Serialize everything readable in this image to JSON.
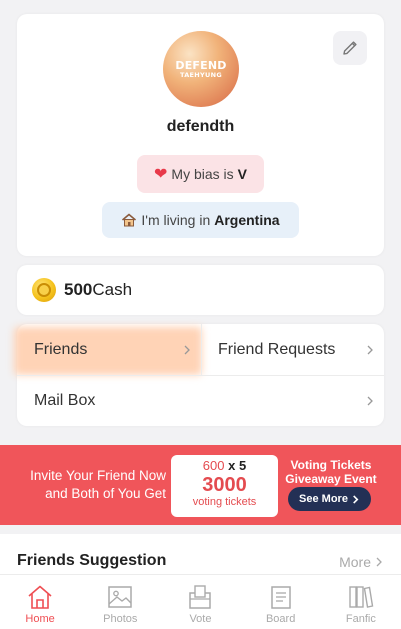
{
  "profile": {
    "avatar_line1": "DEFEND",
    "avatar_line2": "TAEHYUNG",
    "username": "defendth",
    "bias_prefix": "My bias is",
    "bias_value": "V",
    "living_prefix": "I'm living in",
    "living_value": "Argentina"
  },
  "cash": {
    "amount": "500",
    "unit": "Cash"
  },
  "menu": {
    "friends": "Friends",
    "friend_requests": "Friend Requests",
    "mail_box": "Mail Box"
  },
  "banner": {
    "left_line1": "Invite Your Friend Now",
    "left_line2": "and Both of You Get",
    "ticket_count": "600",
    "ticket_times": "x 5",
    "ticket_total": "3000",
    "ticket_unit": "voting tickets",
    "right_line1": "Voting Tickets",
    "right_line2": "Giveaway Event",
    "see_more": "See More"
  },
  "suggestion": {
    "title": "Friends Suggestion",
    "more": "More"
  },
  "tabs": [
    {
      "label": "Home",
      "icon": "home-icon",
      "active": true
    },
    {
      "label": "Photos",
      "icon": "photos-icon",
      "active": false
    },
    {
      "label": "Vote",
      "icon": "vote-icon",
      "active": false
    },
    {
      "label": "Board",
      "icon": "board-icon",
      "active": false
    },
    {
      "label": "Fanfic",
      "icon": "fanfic-icon",
      "active": false
    }
  ],
  "colors": {
    "accent": "#ef4e53",
    "banner": "#f0555a",
    "button_dark": "#233055"
  }
}
